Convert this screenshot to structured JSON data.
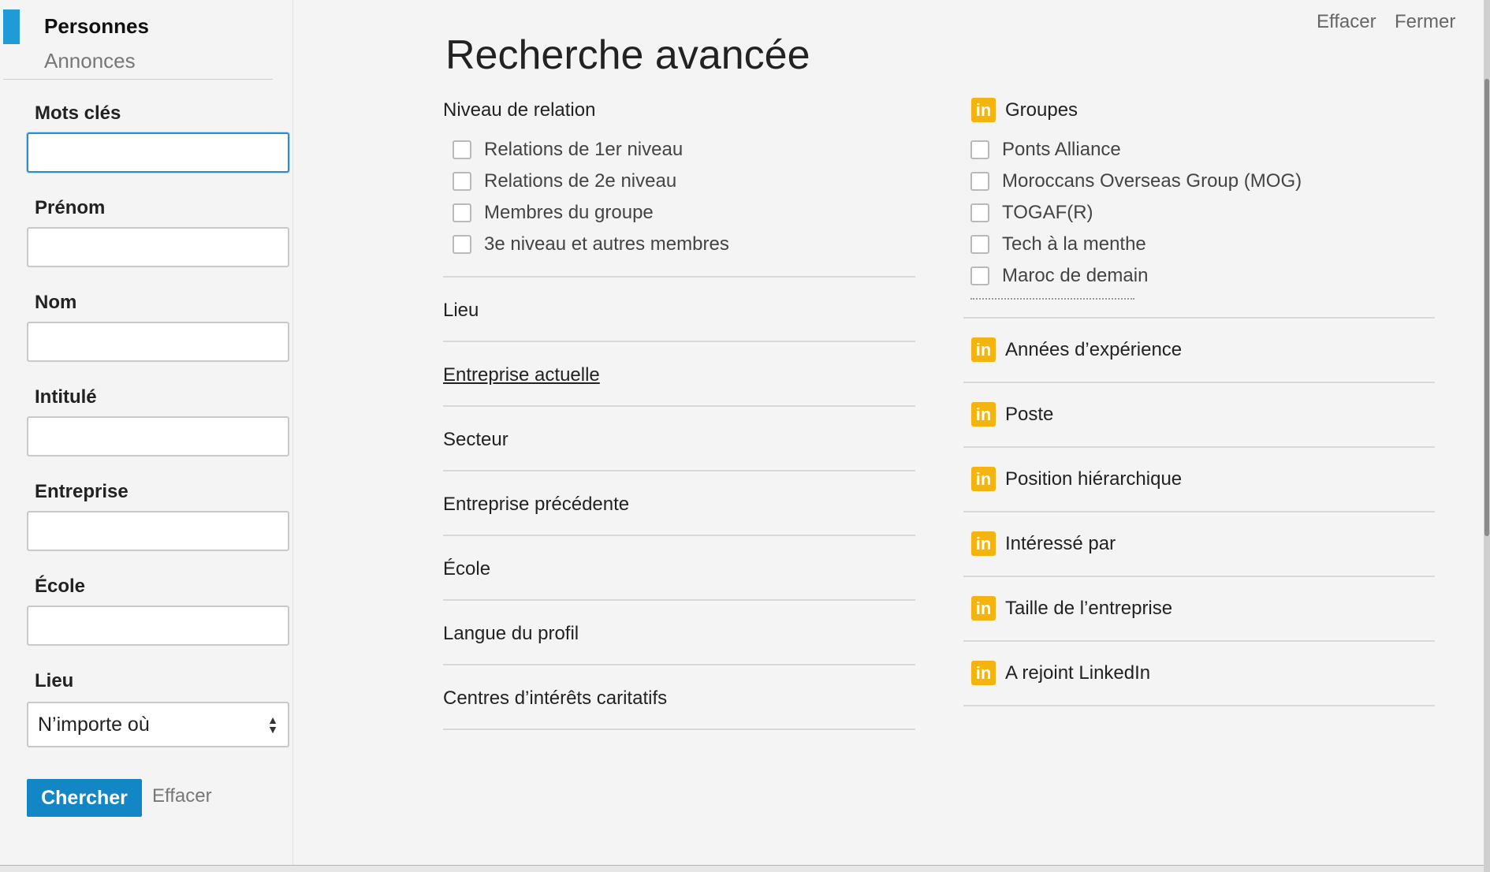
{
  "sidebar": {
    "tabs": [
      {
        "label": "Personnes",
        "active": true
      },
      {
        "label": "Annonces",
        "active": false
      }
    ],
    "fields": [
      {
        "label": "Mots clés",
        "value": "",
        "focused": true
      },
      {
        "label": "Prénom",
        "value": ""
      },
      {
        "label": "Nom",
        "value": ""
      },
      {
        "label": "Intitulé",
        "value": ""
      },
      {
        "label": "Entreprise",
        "value": ""
      },
      {
        "label": "École",
        "value": ""
      }
    ],
    "location": {
      "label": "Lieu",
      "value": "N’importe où"
    },
    "search_button": "Chercher",
    "clear_link": "Effacer"
  },
  "header": {
    "title": "Recherche avancée",
    "clear": "Effacer",
    "close": "Fermer"
  },
  "middle": {
    "relation_header": "Niveau de relation",
    "relation_options": [
      "Relations de 1er niveau",
      "Relations de 2e niveau",
      "Membres du groupe",
      "3e niveau et autres membres"
    ],
    "sections": [
      {
        "label": "Lieu",
        "underlined": false
      },
      {
        "label": "Entreprise actuelle",
        "underlined": true
      },
      {
        "label": "Secteur",
        "underlined": false
      },
      {
        "label": "Entreprise précédente",
        "underlined": false
      },
      {
        "label": "École",
        "underlined": false
      },
      {
        "label": "Langue du profil",
        "underlined": false
      },
      {
        "label": "Centres d’intérêts caritatifs",
        "underlined": false
      }
    ]
  },
  "right": {
    "badge_text": "in",
    "badge_color": "#f4b30e",
    "groups_header": "Groupes",
    "groups": [
      "Ponts Alliance",
      "Moroccans Overseas Group (MOG)",
      "TOGAF(R)",
      "Tech à la menthe",
      "Maroc de demain"
    ],
    "premium_sections": [
      "Années d’expérience",
      "Poste",
      "Position hiérarchique",
      "Intéressé par",
      "Taille de l’entreprise",
      "A rejoint LinkedIn"
    ]
  },
  "colors": {
    "accent": "#1386c6",
    "sidebar_marker": "#1f9bd7"
  }
}
